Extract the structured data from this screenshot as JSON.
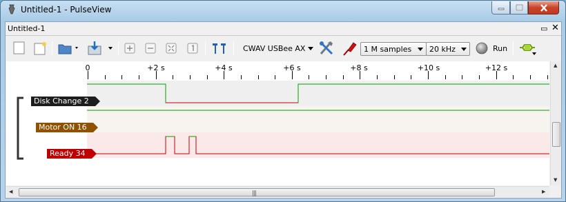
{
  "window": {
    "title": "Untitled-1 - PulseView",
    "colors": {
      "titlebar": "#b7d3ea",
      "close": "#c8432a"
    }
  },
  "document": {
    "title": "Untitled-1"
  },
  "toolbar": {
    "device": "CWAV USBee AX",
    "samples": "1 M samples",
    "samplerate": "20 kHz",
    "run_label": "Run",
    "icons": [
      "new-session-icon",
      "new-view-icon",
      "open-icon",
      "save-icon",
      "zoom-in-icon",
      "zoom-out-icon",
      "zoom-fit-icon",
      "zoom-one-to-one-icon",
      "cursors-icon",
      "device-config-icon",
      "probe-config-icon",
      "run-icon",
      "decoder-icon"
    ]
  },
  "ruler": {
    "ticks": [
      {
        "label": "0"
      },
      {
        "label": "+2 s"
      },
      {
        "label": "+4 s"
      },
      {
        "label": "+6 s"
      },
      {
        "label": "+8 s"
      },
      {
        "label": "+10 s"
      },
      {
        "label": "+12 s"
      }
    ]
  },
  "channels": [
    {
      "name": "Disk Change 2",
      "color": "#1d1d1d",
      "row_bg": "#efefef"
    },
    {
      "name": "Motor ON 16",
      "color": "#8f5200",
      "row_bg": "#f7f3ef"
    },
    {
      "name": "Ready 34",
      "color": "#c00000",
      "row_bg": "#fbe8e8"
    }
  ],
  "colors": {
    "trace_high": "#00a000",
    "trace_low": "#c00000"
  }
}
